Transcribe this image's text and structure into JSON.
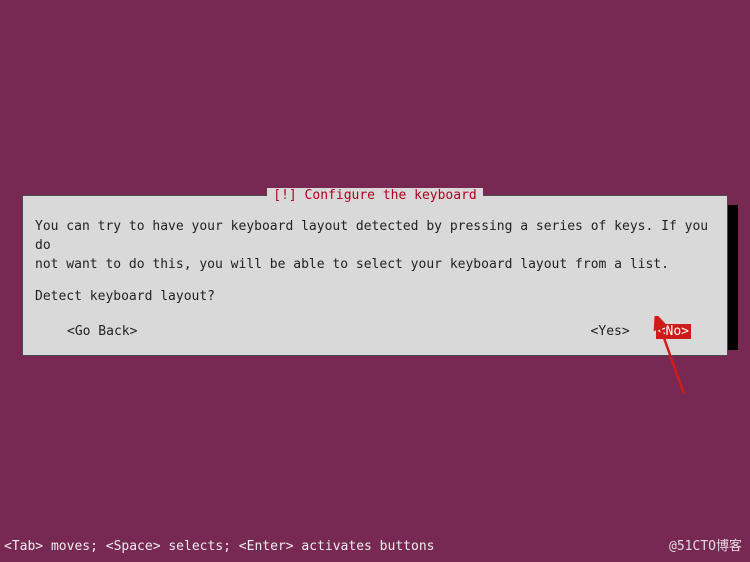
{
  "dialog": {
    "title": "[!] Configure the keyboard",
    "body": "You can try to have your keyboard layout detected by pressing a series of keys. If you do\nnot want to do this, you will be able to select your keyboard layout from a list.",
    "prompt": "Detect keyboard layout?",
    "go_back": "<Go Back>",
    "yes": "<Yes>",
    "no": "<No>"
  },
  "hint": "<Tab> moves; <Space> selects; <Enter> activates buttons",
  "watermark": "@51CTO博客"
}
